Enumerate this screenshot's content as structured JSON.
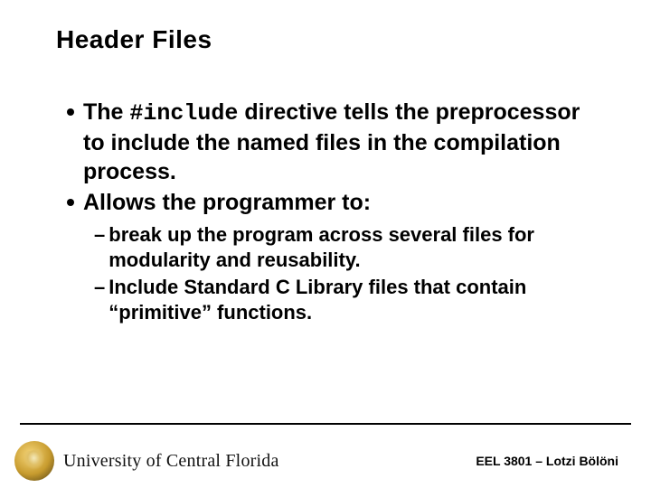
{
  "title": "Header Files",
  "bullets": [
    {
      "pre": "The ",
      "code": "#include",
      "post": " directive tells the preprocessor to include the named files in the compilation process."
    },
    {
      "pre": "Allows the programmer to:",
      "code": "",
      "post": ""
    }
  ],
  "subbullets": [
    "break up the program across several files for modularity and reusability.",
    "Include Standard C Library files that contain “primitive” functions."
  ],
  "footer": {
    "university": "University of Central Florida",
    "course": "EEL 3801 – Lotzi Bölöni"
  }
}
